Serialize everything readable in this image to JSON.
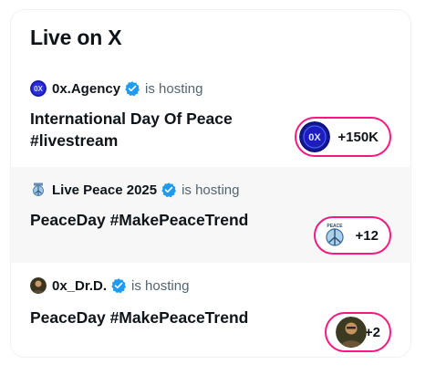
{
  "title": "Live on X",
  "items": [
    {
      "host": "0x.Agency",
      "hosting": "is hosting",
      "title_lines": [
        "International Day Of Peace",
        "#livestream"
      ],
      "listeners": "+150K",
      "avatar_text": "0X"
    },
    {
      "host": "Live Peace 2025",
      "hosting": "is hosting",
      "title": "PeaceDay #MakePeaceTrend",
      "listeners": "+12",
      "avatar_text": "PEACE"
    },
    {
      "host": "0x_Dr.D.",
      "hosting": "is hosting",
      "title": "PeaceDay #MakePeaceTrend",
      "listeners": "+2"
    }
  ],
  "colors": {
    "accent_pink": "#f91880",
    "verified_blue": "#1d9bf0",
    "secondary_text": "#536471"
  },
  "icons": [
    "verified-badge-icon"
  ]
}
